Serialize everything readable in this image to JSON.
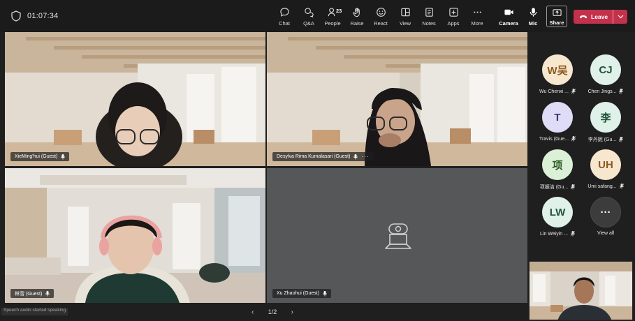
{
  "meeting": {
    "timer": "01:07:34"
  },
  "toolbar": {
    "chat": "Chat",
    "qa": "Q&A",
    "people": "People",
    "people_count": "23",
    "raise": "Raise",
    "react": "React",
    "view": "View",
    "notes": "Notes",
    "apps": "Apps",
    "more": "More",
    "camera": "Camera",
    "mic": "Mic",
    "share": "Share",
    "leave": "Leave"
  },
  "tiles": [
    {
      "name": "XieMing'hui (Guest)"
    },
    {
      "name": "Desylva Rima Kumalasari (Guest)"
    },
    {
      "name": "林雪 (Guest)"
    },
    {
      "name": "Xu Zhaohui (Guest)"
    }
  ],
  "pager": {
    "label": "1/2",
    "prev": "‹",
    "next": "›"
  },
  "participants": [
    {
      "initials": "W吴",
      "name": "Wu Chenxi ..."
    },
    {
      "initials": "CJ",
      "name": "Chen Jings..."
    },
    {
      "initials": "T",
      "name": "Travis (Gue..."
    },
    {
      "initials": "李",
      "name": "李丹妮 (Gu..."
    },
    {
      "initials": "项",
      "name": "项振洁 (Gu..."
    },
    {
      "initials": "UH",
      "name": "Umi safang..."
    },
    {
      "initials": "LW",
      "name": "Lin Weiyin ..."
    },
    {
      "initials": "···",
      "name": "View all"
    }
  ],
  "overlay_text": "Speech audio started speaking"
}
